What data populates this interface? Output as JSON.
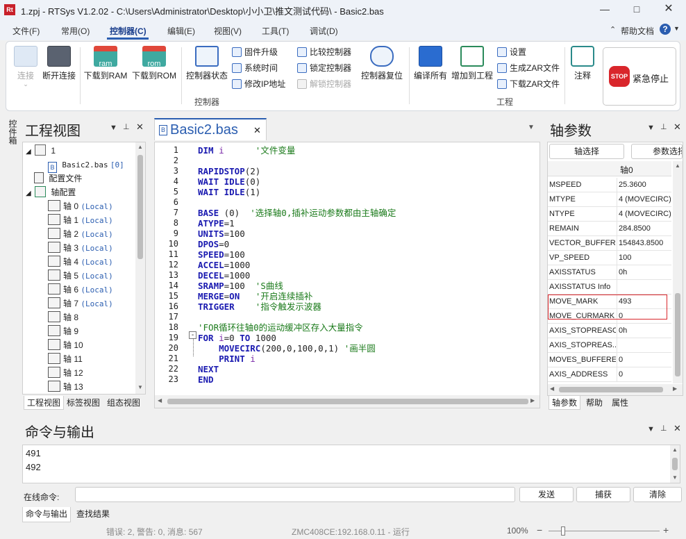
{
  "window": {
    "title": "1.zpj - RTSys V1.2.02 - C:\\Users\\Administrator\\Desktop\\小小卫\\推文测试代码\\ - Basic2.bas",
    "app_icon": "Rt"
  },
  "menu": [
    "文件(F)",
    "常用(O)",
    "控制器(C)",
    "编辑(E)",
    "视图(V)",
    "工具(T)",
    "调试(D)"
  ],
  "menu_right": {
    "help": "帮助文档",
    "help_icon": "?"
  },
  "ribbon": {
    "connect": "连接",
    "disconnect": "断开连接",
    "download_ram": "下载到RAM",
    "download_rom": "下载到ROM",
    "ram_tag": "ram",
    "rom_tag": "rom",
    "controller_status": "控制器状态",
    "firmware_upgrade": "固件升级",
    "system_time": "系统时间",
    "modify_ip": "修改IP地址",
    "compare_controller": "比较控制器",
    "lock_controller": "锁定控制器",
    "unlock_controller": "解锁控制器",
    "controller_reset": "控制器复位",
    "group_controller": "控制器",
    "compile_all": "编译所有",
    "add_to_project": "增加到工程",
    "settings": "设置",
    "gen_zar": "生成ZAR文件",
    "download_zar": "下载ZAR文件",
    "group_project": "工程",
    "comment": "注释",
    "emergency_stop": "紧急停止",
    "stop_text": "STOP"
  },
  "side_tab": "控件箱",
  "project_view": {
    "title": "工程视图",
    "root": "1",
    "file": "Basic2.bas",
    "file_tag": "[0]",
    "config_file": "配置文件",
    "axis_config": "轴配置",
    "axes": [
      {
        "label": "轴 0",
        "tag": "(Local)"
      },
      {
        "label": "轴 1",
        "tag": "(Local)"
      },
      {
        "label": "轴 2",
        "tag": "(Local)"
      },
      {
        "label": "轴 3",
        "tag": "(Local)"
      },
      {
        "label": "轴 4",
        "tag": "(Local)"
      },
      {
        "label": "轴 5",
        "tag": "(Local)"
      },
      {
        "label": "轴 6",
        "tag": "(Local)"
      },
      {
        "label": "轴 7",
        "tag": "(Local)"
      },
      {
        "label": "轴 8",
        "tag": ""
      },
      {
        "label": "轴 9",
        "tag": ""
      },
      {
        "label": "轴 10",
        "tag": ""
      },
      {
        "label": "轴 11",
        "tag": ""
      },
      {
        "label": "轴 12",
        "tag": ""
      },
      {
        "label": "轴 13",
        "tag": ""
      }
    ],
    "tabs": [
      "工程视图",
      "标签视图",
      "组态视图"
    ]
  },
  "editor": {
    "tab_label": "Basic2.bas",
    "tab_icon": "B",
    "lines": [
      {
        "n": "1",
        "code": [
          [
            "kw",
            "DIM"
          ],
          [
            "nm",
            " "
          ],
          [
            "var",
            "i"
          ],
          [
            "nm",
            "      "
          ],
          [
            "cm",
            "'文件变量"
          ]
        ]
      },
      {
        "n": "2",
        "code": []
      },
      {
        "n": "3",
        "code": [
          [
            "kw",
            "RAPIDSTOP"
          ],
          [
            "nm",
            "(2)"
          ]
        ]
      },
      {
        "n": "4",
        "code": [
          [
            "kw",
            "WAIT IDLE"
          ],
          [
            "nm",
            "(0)"
          ]
        ]
      },
      {
        "n": "5",
        "code": [
          [
            "kw",
            "WAIT IDLE"
          ],
          [
            "nm",
            "(1)"
          ]
        ]
      },
      {
        "n": "6",
        "code": []
      },
      {
        "n": "7",
        "code": [
          [
            "kw",
            "BASE"
          ],
          [
            "nm",
            " (0)  "
          ],
          [
            "cm",
            "'选择轴0,插补运动参数都由主轴确定"
          ]
        ]
      },
      {
        "n": "8",
        "code": [
          [
            "kw",
            "ATYPE"
          ],
          [
            "nm",
            "=1"
          ]
        ]
      },
      {
        "n": "9",
        "code": [
          [
            "kw",
            "UNITS"
          ],
          [
            "nm",
            "=100"
          ]
        ]
      },
      {
        "n": "10",
        "code": [
          [
            "kw",
            "DPOS"
          ],
          [
            "nm",
            "=0"
          ]
        ]
      },
      {
        "n": "11",
        "code": [
          [
            "kw",
            "SPEED"
          ],
          [
            "nm",
            "=100"
          ]
        ]
      },
      {
        "n": "12",
        "code": [
          [
            "kw",
            "ACCEL"
          ],
          [
            "nm",
            "=1000"
          ]
        ]
      },
      {
        "n": "13",
        "code": [
          [
            "kw",
            "DECEL"
          ],
          [
            "nm",
            "=1000"
          ]
        ]
      },
      {
        "n": "14",
        "code": [
          [
            "kw",
            "SRAMP"
          ],
          [
            "nm",
            "=100  "
          ],
          [
            "cm",
            "'S曲线"
          ]
        ]
      },
      {
        "n": "15",
        "code": [
          [
            "kw",
            "MERGE"
          ],
          [
            "nm",
            "="
          ],
          [
            "kw",
            "ON"
          ],
          [
            "nm",
            "   "
          ],
          [
            "cm",
            "'开启连续插补"
          ]
        ]
      },
      {
        "n": "16",
        "code": [
          [
            "kw",
            "TRIGGER"
          ],
          [
            "nm",
            "    "
          ],
          [
            "cm",
            "'指令触发示波器"
          ]
        ]
      },
      {
        "n": "17",
        "code": []
      },
      {
        "n": "18",
        "code": [
          [
            "cm",
            "'FOR循环往轴0的运动缓冲区存入大量指令"
          ]
        ]
      },
      {
        "n": "19",
        "code": [
          [
            "kw",
            "FOR"
          ],
          [
            "nm",
            " "
          ],
          [
            "var",
            "i"
          ],
          [
            "nm",
            "=0 "
          ],
          [
            "kw",
            "TO"
          ],
          [
            "nm",
            " 1000"
          ]
        ]
      },
      {
        "n": "20",
        "code": [
          [
            "nm",
            "    "
          ],
          [
            "kw",
            "MOVECIRC"
          ],
          [
            "nm",
            "(200,0,100,0,1) "
          ],
          [
            "cm",
            "'画半圆"
          ]
        ]
      },
      {
        "n": "21",
        "code": [
          [
            "nm",
            "    "
          ],
          [
            "kw",
            "PRINT"
          ],
          [
            "nm",
            " "
          ],
          [
            "var",
            "i"
          ]
        ]
      },
      {
        "n": "22",
        "code": [
          [
            "kw",
            "NEXT"
          ]
        ]
      },
      {
        "n": "23",
        "code": [
          [
            "kw",
            "END"
          ]
        ]
      }
    ]
  },
  "axis_params": {
    "title": "轴参数",
    "btn_axis_select": "轴选择",
    "btn_param_select": "参数选择",
    "col_header": "轴0",
    "rows": [
      {
        "key": "MSPEED",
        "val": "25.3600"
      },
      {
        "key": "MTYPE",
        "val": "4 (MOVECIRC)"
      },
      {
        "key": "NTYPE",
        "val": "4 (MOVECIRC)"
      },
      {
        "key": "REMAIN",
        "val": "284.8500"
      },
      {
        "key": "VECTOR_BUFFERED",
        "val": "154843.8500"
      },
      {
        "key": "VP_SPEED",
        "val": "100"
      },
      {
        "key": "AXISSTATUS",
        "val": "0h"
      },
      {
        "key": "AXISSTATUS Info",
        "val": ""
      },
      {
        "key": "MOVE_MARK",
        "val": "493"
      },
      {
        "key": "MOVE_CURMARK",
        "val": "0"
      },
      {
        "key": "AXIS_STOPREASON",
        "val": "0h"
      },
      {
        "key": "AXIS_STOPREAS...",
        "val": ""
      },
      {
        "key": "MOVES_BUFFERED",
        "val": "0"
      },
      {
        "key": "AXIS_ADDRESS",
        "val": "0"
      }
    ],
    "tabs": [
      "轴参数",
      "帮助",
      "属性"
    ],
    "highlight_color": "#d9262b"
  },
  "command": {
    "title": "命令与输出",
    "output": [
      "491",
      "492"
    ],
    "online_label": "在线命令:",
    "send": "发送",
    "capture": "捕获",
    "clear": "清除",
    "tabs": [
      "命令与输出",
      "查找结果"
    ]
  },
  "status": {
    "errors": "错误: 2, 警告: 0, 消息: 567",
    "connection": "ZMC408CE:192.168.0.11 - 运行",
    "zoom": "100%"
  }
}
